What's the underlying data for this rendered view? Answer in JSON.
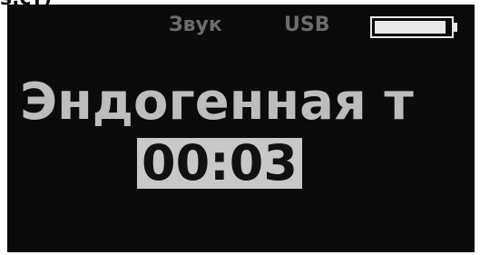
{
  "top_fragment": "ѕ.ст)",
  "status": {
    "sound_label": "Звук",
    "usb_label": "USB"
  },
  "battery": {
    "level": 0.95,
    "icon": "battery-icon"
  },
  "message": "Эндогенная т",
  "timer": "00:03",
  "colors": {
    "screen_bg": "#0b0b0b",
    "status_text": "#6c6c6c",
    "message_text": "#bdbdbd",
    "timer_bg": "#c8c8c8",
    "timer_text": "#111111"
  }
}
